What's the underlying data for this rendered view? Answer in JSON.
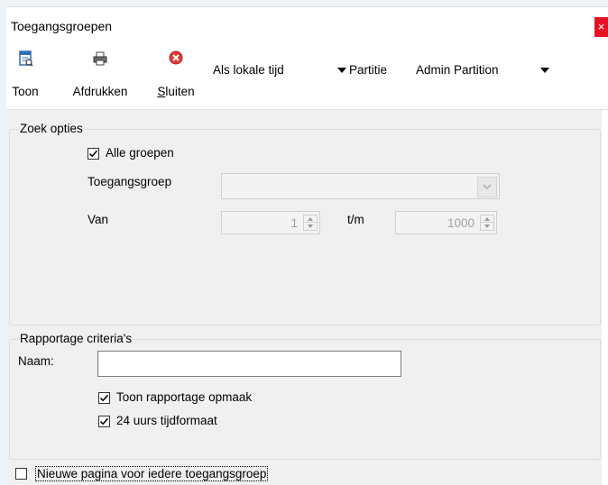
{
  "window": {
    "title": "Toegangsgroepen",
    "close_label": "×"
  },
  "toolbar": {
    "toon_label": "Toon",
    "afdrukken_label": "Afdrukken",
    "sluiten_prefix": "S",
    "sluiten_rest": "luiten",
    "time_mode": "Als lokale tijd",
    "partitie_label": "Partitie",
    "partition_value": "Admin Partition"
  },
  "zoek_opties": {
    "title": "Zoek opties",
    "alle_groepen_label": "Alle groepen",
    "alle_groepen_checked": true,
    "toegangsgroep_label": "Toegangsgroep",
    "toegangsgroep_value": "",
    "van_label": "Van",
    "van_value": "1",
    "tm_label": "t/m",
    "tm_value": "1000"
  },
  "rapportage": {
    "title": "Rapportage criteria's",
    "naam_label": "Naam:",
    "naam_value": "",
    "toon_opmaak_label": "Toon rapportage opmaak",
    "toon_opmaak_checked": true,
    "tijdformaat_label": "24 uurs tijdformaat",
    "tijdformaat_checked": true
  },
  "footer": {
    "nieuwe_pagina_label": "Nieuwe pagina voor iedere toegangsgroep",
    "nieuwe_pagina_checked": false
  },
  "colors": {
    "close_red": "#e81123",
    "panel_bg": "#f0f0f0",
    "icon_blue": "#2e6fb5"
  }
}
